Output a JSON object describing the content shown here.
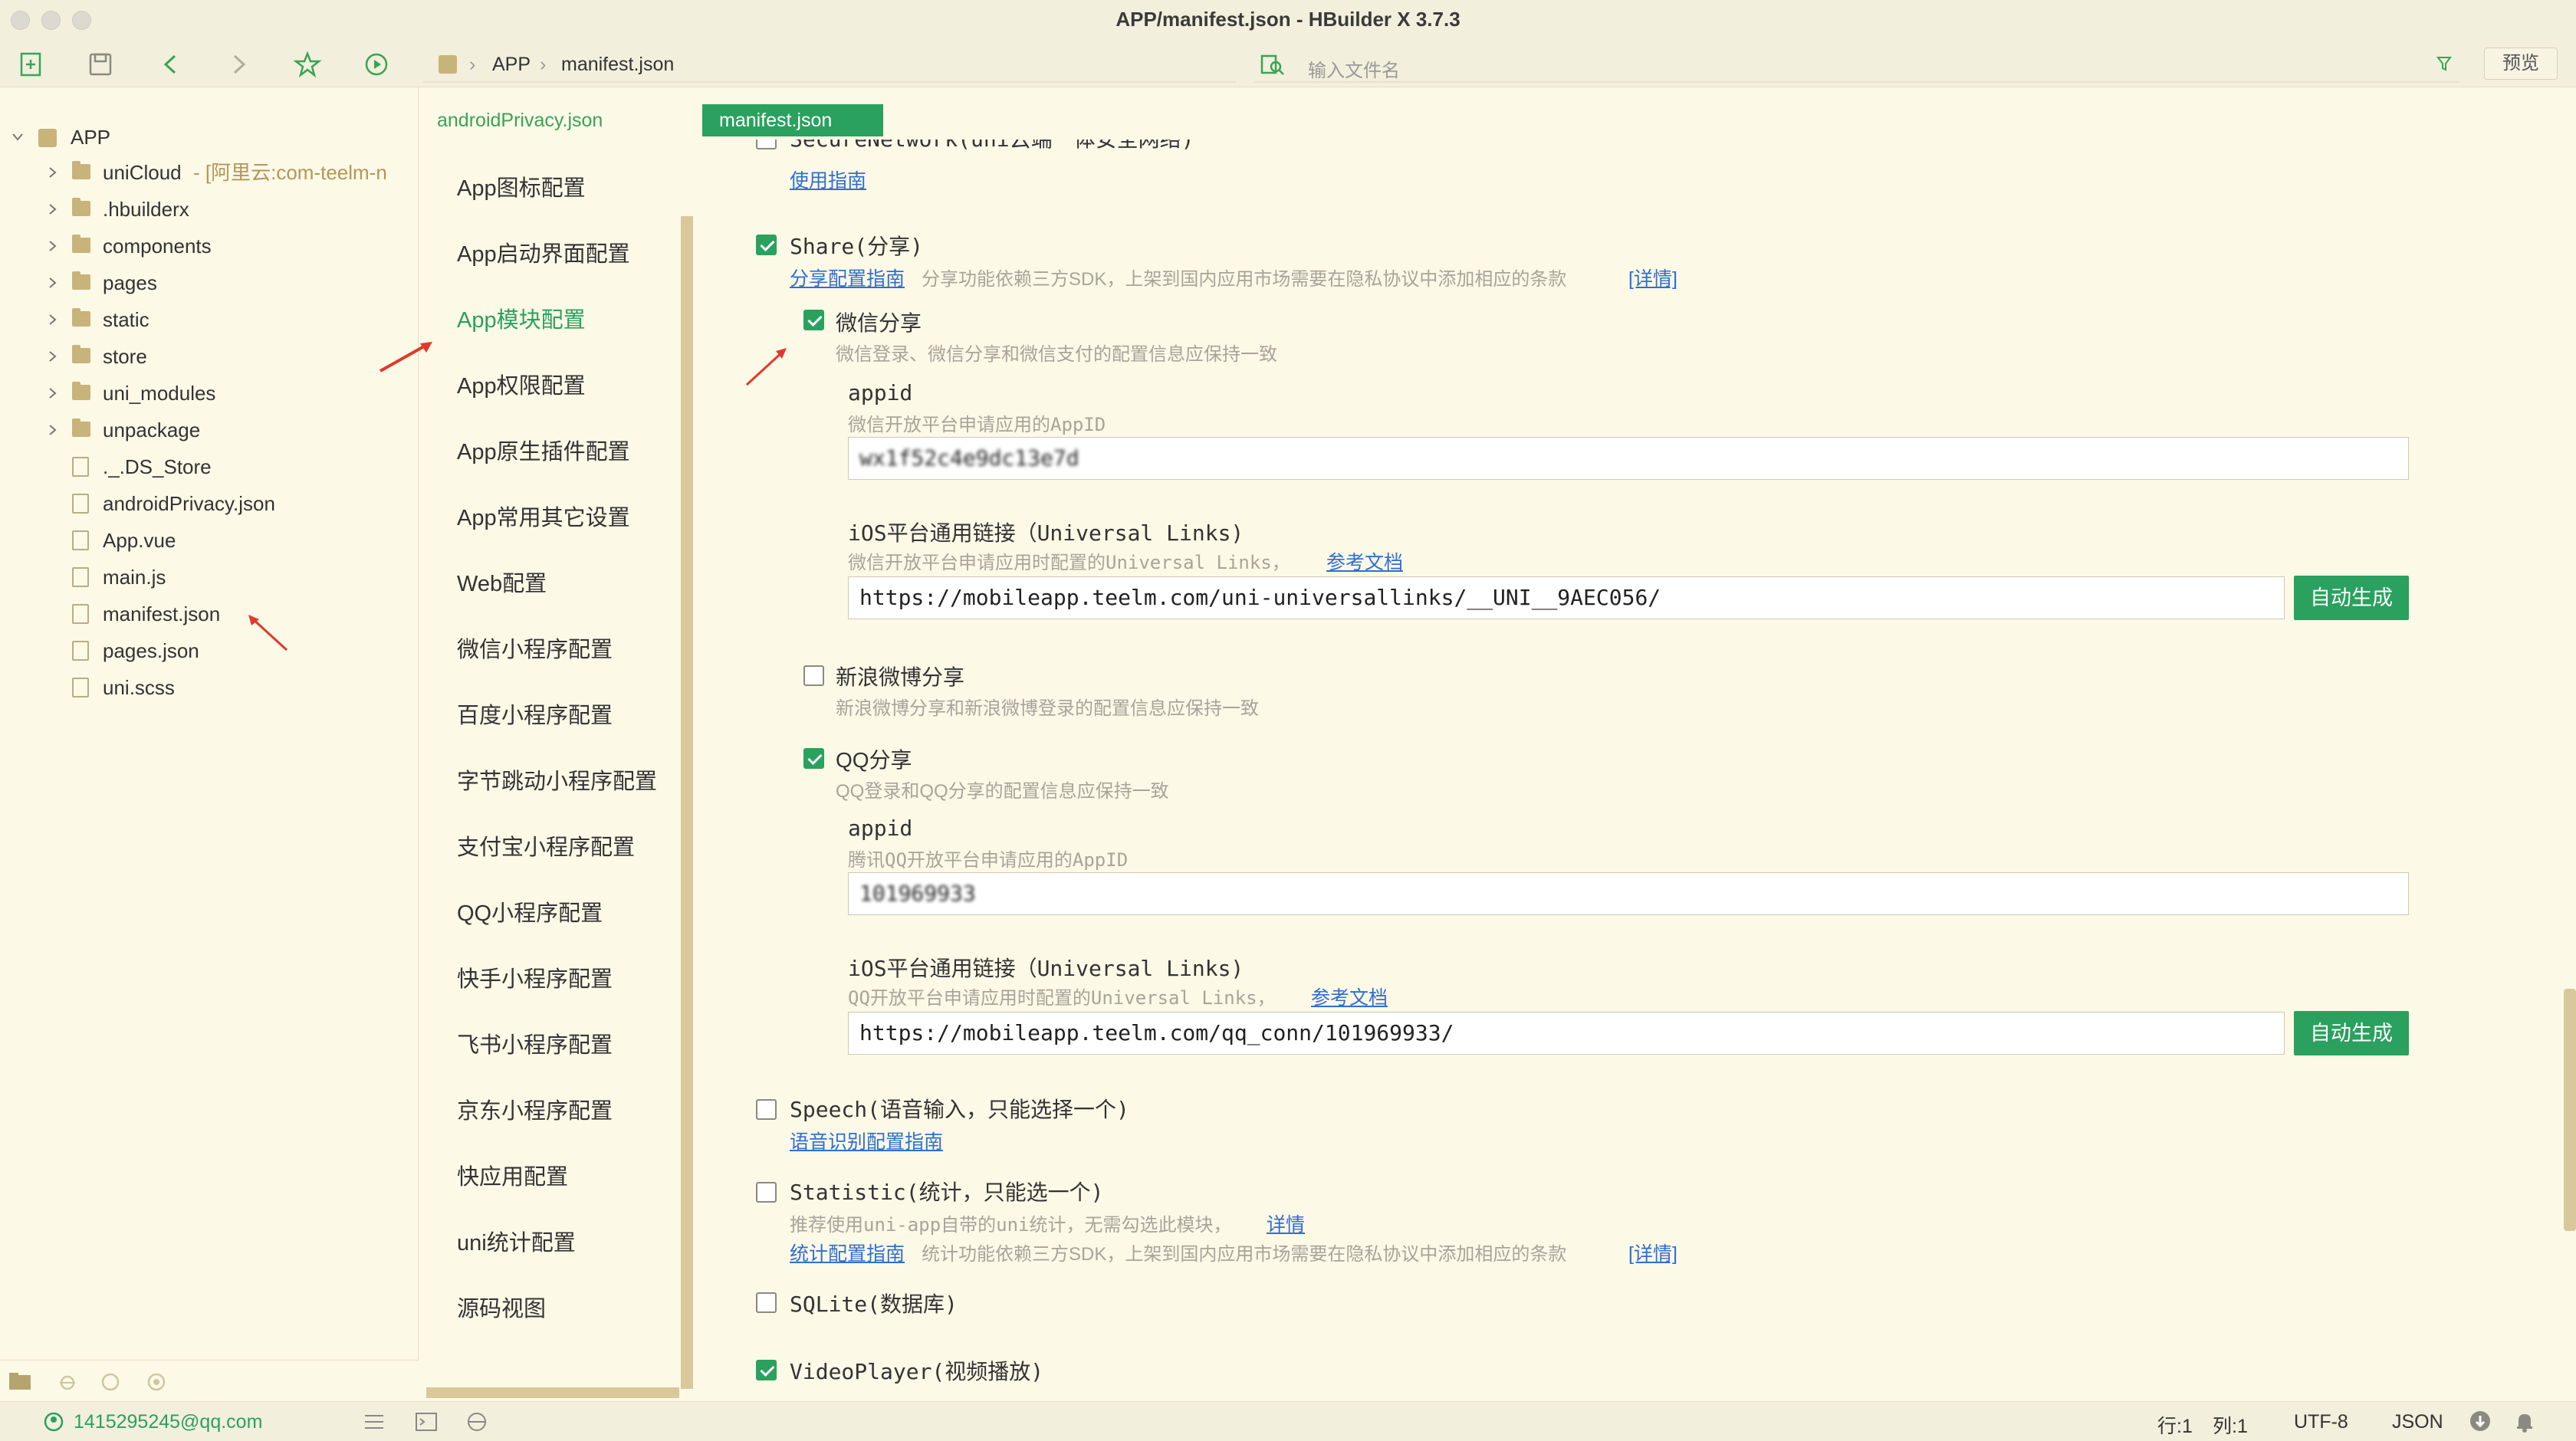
{
  "window": {
    "title": "APP/manifest.json - HBuilder X 3.7.3"
  },
  "toolbar": {
    "icons": [
      "new-file-icon",
      "save-icon",
      "back-icon",
      "forward-icon",
      "star-icon",
      "run-icon"
    ],
    "breadcrumb": [
      "APP",
      "manifest.json"
    ],
    "file_search_placeholder": "输入文件名",
    "preview_label": "预览"
  },
  "explorer": {
    "root": "APP",
    "items": [
      {
        "label": "uniCloud",
        "suffix": " - [阿里云:com-teelm-n",
        "type": "folder"
      },
      {
        "label": ".hbuilderx",
        "type": "folder"
      },
      {
        "label": "components",
        "type": "folder"
      },
      {
        "label": "pages",
        "type": "folder"
      },
      {
        "label": "static",
        "type": "folder"
      },
      {
        "label": "store",
        "type": "folder"
      },
      {
        "label": "uni_modules",
        "type": "folder"
      },
      {
        "label": "unpackage",
        "type": "folder"
      },
      {
        "label": "._.DS_Store",
        "type": "file"
      },
      {
        "label": "androidPrivacy.json",
        "type": "file"
      },
      {
        "label": "App.vue",
        "type": "file"
      },
      {
        "label": "main.js",
        "type": "file"
      },
      {
        "label": "manifest.json",
        "type": "file"
      },
      {
        "label": "pages.json",
        "type": "file"
      },
      {
        "label": "uni.scss",
        "type": "file"
      }
    ]
  },
  "tabs": [
    {
      "label": "androidPrivacy.json",
      "active": false
    },
    {
      "label": "manifest.json",
      "active": true
    }
  ],
  "nav": {
    "items": [
      "App图标配置",
      "App启动界面配置",
      "App模块配置",
      "App权限配置",
      "App原生插件配置",
      "App常用其它设置",
      "Web配置",
      "微信小程序配置",
      "百度小程序配置",
      "字节跳动小程序配置",
      "支付宝小程序配置",
      "QQ小程序配置",
      "快手小程序配置",
      "飞书小程序配置",
      "京东小程序配置",
      "快应用配置",
      "uni统计配置",
      "源码视图"
    ],
    "active_index": 2
  },
  "content": {
    "secure_network_label": "SecureNetwork(uni云端一体安全网络)",
    "secure_network_link": "使用指南",
    "share": {
      "label": "Share(分享)",
      "checked": true,
      "guide_link": "分享配置指南",
      "desc": "分享功能依赖三方SDK，上架到国内应用市场需要在隐私协议中添加相应的条款",
      "detail_link": "[详情]",
      "weixin": {
        "label": "微信分享",
        "checked": true,
        "desc": "微信登录、微信分享和微信支付的配置信息应保持一致",
        "appid_label": "appid",
        "appid_desc": "微信开放平台申请应用的AppID",
        "appid_value": "wx1f52c4e9dc13e7d",
        "ul_label": "iOS平台通用链接（Universal Links)",
        "ul_desc": "微信开放平台申请应用时配置的Universal Links，",
        "ul_doc_link": "参考文档",
        "ul_value": "https://mobileapp.teelm.com/uni-universallinks/__UNI__9AEC056/",
        "gen_label": "自动生成"
      },
      "sina": {
        "label": "新浪微博分享",
        "checked": false,
        "desc": "新浪微博分享和新浪微博登录的配置信息应保持一致"
      },
      "qq": {
        "label": "QQ分享",
        "checked": true,
        "desc": "QQ登录和QQ分享的配置信息应保持一致",
        "appid_label": "appid",
        "appid_desc": "腾讯QQ开放平台申请应用的AppID",
        "appid_value": "101969933",
        "ul_label": "iOS平台通用链接（Universal Links)",
        "ul_desc": "QQ开放平台申请应用时配置的Universal Links，",
        "ul_doc_link": "参考文档",
        "ul_value": "https://mobileapp.teelm.com/qq_conn/101969933/",
        "gen_label": "自动生成"
      }
    },
    "speech": {
      "label": "Speech(语音输入，只能选择一个)",
      "checked": false,
      "link": "语音识别配置指南"
    },
    "statistic": {
      "label": "Statistic(统计，只能选一个)",
      "checked": false,
      "desc1": "推荐使用uni-app自带的uni统计，无需勾选此模块，",
      "desc1_link": "详情",
      "guide_link": "统计配置指南",
      "desc2": "统计功能依赖三方SDK，上架到国内应用市场需要在隐私协议中添加相应的条款",
      "detail_link": "[详情]"
    },
    "sqlite": {
      "label": "SQLite(数据库)",
      "checked": false
    },
    "videoplayer": {
      "label": "VideoPlayer(视频播放)",
      "checked": true
    }
  },
  "statusbar": {
    "account": "1415295245@qq.com",
    "line": "行:1",
    "col": "列:1",
    "encoding": "UTF-8",
    "lang": "JSON"
  },
  "colors": {
    "accent": "#2aa15e",
    "background": "#fcf9e7",
    "link": "#2f6fd0",
    "annotation_arrow": "#e0392b"
  }
}
